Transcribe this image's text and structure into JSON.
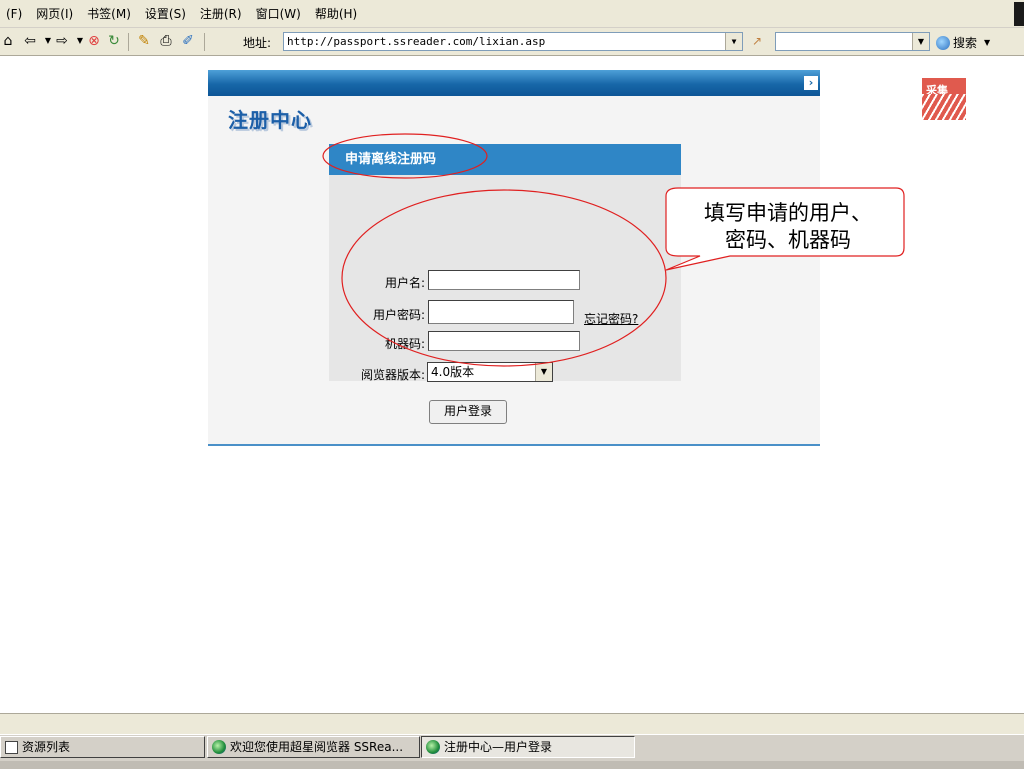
{
  "menubar": {
    "items": [
      "(F)",
      "网页(I)",
      "书签(M)",
      "设置(S)",
      "注册(R)",
      "窗口(W)",
      "帮助(H)"
    ]
  },
  "toolbar": {
    "address_label": "地址:",
    "address_value": "http://passport.ssreader.com/lixian.asp",
    "search_label": "搜索"
  },
  "page": {
    "title": "注册中心",
    "panel_title": "申请离线注册码",
    "form": {
      "username_label": "用户名:",
      "username_value": "",
      "password_label": "用户密码:",
      "password_value": "",
      "forgot_link": "忘记密码?",
      "machine_label": "机器码:",
      "machine_value": "",
      "browser_label": "阅览器版本:",
      "browser_selected": "4.0版本",
      "login_button": "用户登录"
    },
    "logo_text": "采集"
  },
  "annotation": {
    "callout_text": "填写申请的用户、密码、机器码",
    "callout_line1": "填写申请的用户、",
    "callout_line2": "密码、机器码",
    "stroke_color": "#e02020"
  },
  "taskbar": {
    "tasks": [
      "资源列表",
      "欢迎您使用超星阅览器 SSRea...",
      "注册中心—用户登录"
    ]
  }
}
